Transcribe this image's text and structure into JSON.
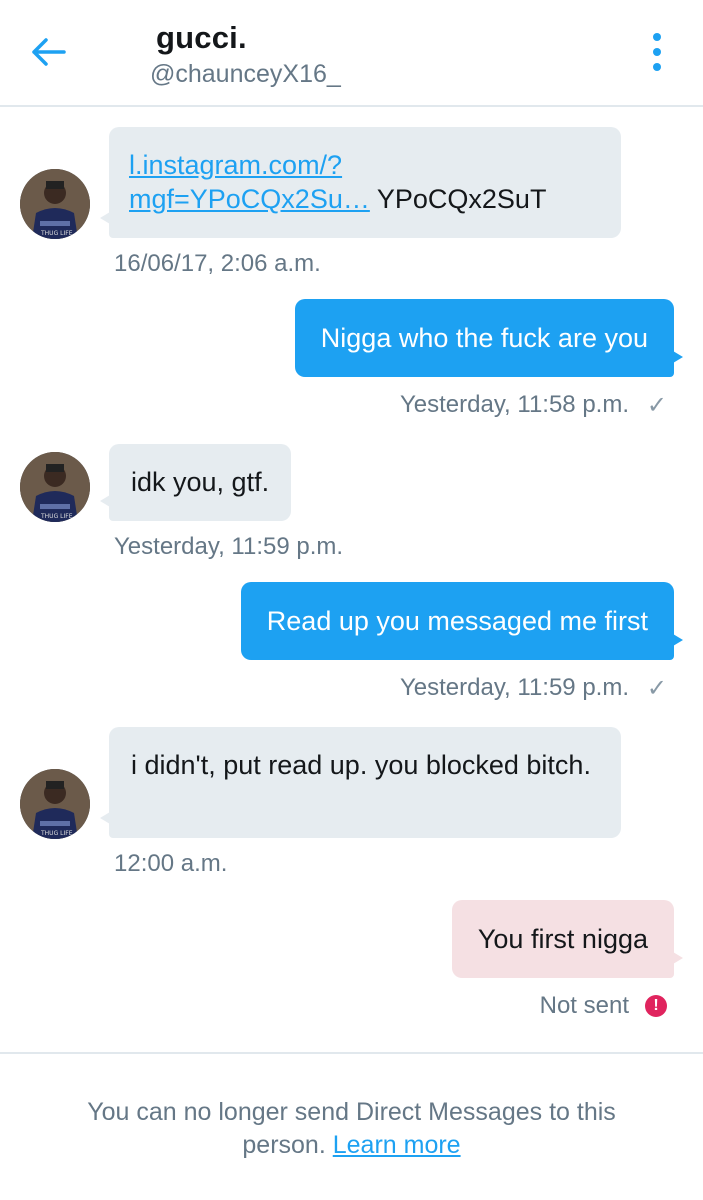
{
  "header": {
    "title": "gucci.",
    "handle": "@chaunceyX16_",
    "back_icon": "arrow-left-icon",
    "menu_icon": "more-vertical-icon",
    "accent": "#1da1f2"
  },
  "messages": [
    {
      "direction": "in",
      "link_text_1": "l.instagram.com/?",
      "link_text_2": "mgf=YPoCQx2Su…",
      "suffix": " YPoCQx2SuT",
      "timestamp": "16/06/17, 2:06 a.m."
    },
    {
      "direction": "out",
      "text": "Nigga who the fuck are you",
      "timestamp": "Yesterday, 11:58 p.m.",
      "status": "✓"
    },
    {
      "direction": "in",
      "text": "idk you, gtf.",
      "timestamp": "Yesterday, 11:59 p.m."
    },
    {
      "direction": "out",
      "text": "Read up you messaged me first",
      "timestamp": "Yesterday, 11:59 p.m.",
      "status": "✓"
    },
    {
      "direction": "in",
      "text": "i didn't, put read up. you blocked bitch.",
      "timestamp": "12:00 a.m."
    },
    {
      "direction": "out",
      "text": "You first nigga",
      "timestamp": "Not sent",
      "status": "!"
    }
  ],
  "footer": {
    "text": "You can no longer send Direct Messages to this person. ",
    "link": "Learn more"
  },
  "colors": {
    "incoming_bubble": "#e6ecf0",
    "outgoing_bubble": "#1da1f2",
    "failed_bubble": "#f5e0e3",
    "error": "#e0245e"
  }
}
